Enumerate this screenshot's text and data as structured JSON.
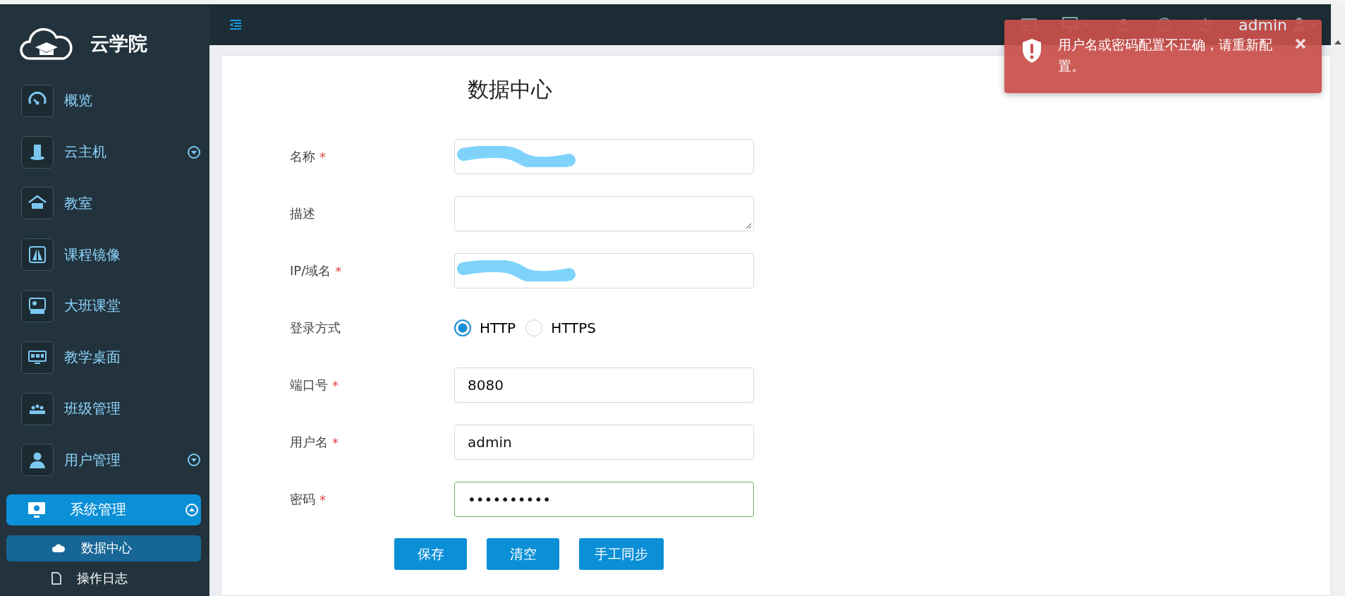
{
  "sidebar": {
    "logo_text": "云学院",
    "items": [
      {
        "label": "概览",
        "selected": false
      },
      {
        "label": "云主机",
        "selected": false,
        "expanded": false
      },
      {
        "label": "教室",
        "selected": false
      },
      {
        "label": "课程镜像",
        "selected": false
      },
      {
        "label": "大班课堂",
        "selected": false
      },
      {
        "label": "教学桌面",
        "selected": false
      },
      {
        "label": "班级管理",
        "selected": false
      },
      {
        "label": "用户管理",
        "selected": false,
        "expanded": false
      },
      {
        "label": "系统管理",
        "selected": true,
        "expanded": true,
        "children": [
          {
            "label": "数据中心",
            "selected": true
          },
          {
            "label": "操作日志",
            "selected": false
          }
        ]
      }
    ]
  },
  "topbar": {
    "user": "admin"
  },
  "form": {
    "title": "数据中心",
    "fields": [
      {
        "label": "名称",
        "required_mark": "*",
        "kind": "text",
        "redacted": true
      },
      {
        "label": "描述",
        "kind": "textarea"
      },
      {
        "label": "IP/域名",
        "required_mark": "*",
        "kind": "text",
        "redacted": true
      },
      {
        "label": "登录方式",
        "kind": "radio",
        "options": [
          {
            "label": "HTTP",
            "selected": true
          },
          {
            "label": "HTTPS",
            "selected": false
          }
        ]
      },
      {
        "label": "端口号",
        "required_mark": "*",
        "kind": "text",
        "value": "8080"
      },
      {
        "label": "用户名",
        "required_mark": "*",
        "kind": "text",
        "value": "admin"
      },
      {
        "label": "密码",
        "required_mark": "*",
        "kind": "text",
        "value": "••••••••••",
        "valid": true
      }
    ],
    "buttons": [
      "保存",
      "清空",
      "手工同步"
    ]
  },
  "toast": {
    "message": "用户名或密码配置不正确，请重新配置。"
  }
}
